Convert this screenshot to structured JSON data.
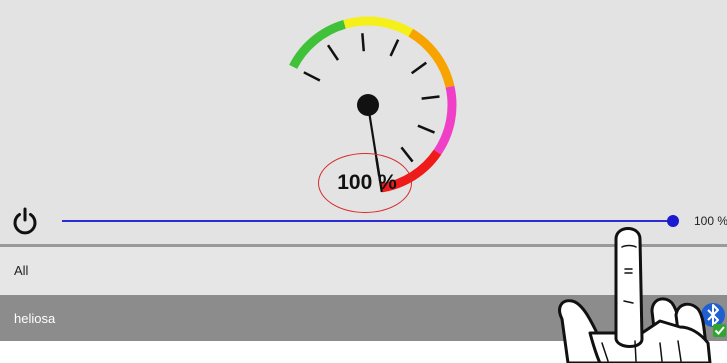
{
  "gauge": {
    "value_text": "100 %",
    "level_percent": 100,
    "segment_colors": [
      "#3fc23a",
      "#f5ef1a",
      "#f7a400",
      "#f03fc7",
      "#ef1b1b"
    ]
  },
  "brightness": {
    "value_percent": 100,
    "readout": "100 %",
    "track_color": "#2d2bd6"
  },
  "power": {
    "icon": "power-icon"
  },
  "list": {
    "all_label": "All",
    "device_label": "heliosa",
    "device_icons": [
      "bluetooth-icon",
      "check-icon"
    ]
  },
  "overlay": {
    "icon": "pointing-hand-icon"
  }
}
